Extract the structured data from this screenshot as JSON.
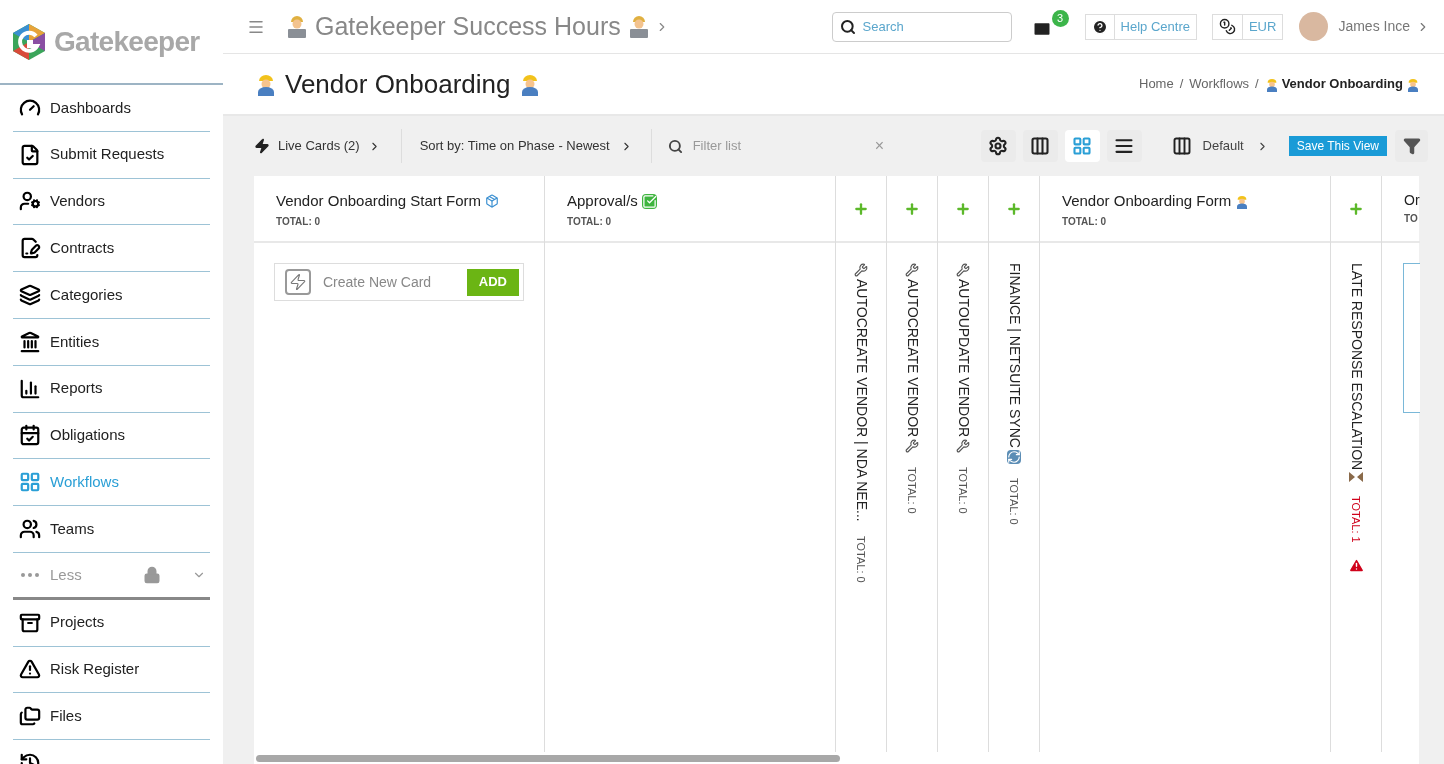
{
  "logo": {
    "text": "Gatekeeper"
  },
  "topbar": {
    "title": "Gatekeeper Success Hours",
    "search": {
      "placeholder": "Search"
    },
    "mail_badge": "3",
    "help": "Help Centre",
    "currency": "EUR",
    "user": "James Ince"
  },
  "sidebar": {
    "items": [
      {
        "kind": "link",
        "label": "Dashboards",
        "selected": false
      },
      {
        "kind": "link",
        "label": "Submit Requests",
        "selected": false
      },
      {
        "kind": "link",
        "label": "Vendors",
        "selected": false
      },
      {
        "kind": "link",
        "label": "Contracts",
        "selected": false
      },
      {
        "kind": "link",
        "label": "Categories",
        "selected": false
      },
      {
        "kind": "link",
        "label": "Entities",
        "selected": false
      },
      {
        "kind": "link",
        "label": "Reports",
        "selected": false
      },
      {
        "kind": "link",
        "label": "Obligations",
        "selected": false
      },
      {
        "kind": "link",
        "label": "Workflows",
        "selected": true
      },
      {
        "kind": "link",
        "label": "Teams",
        "selected": false
      },
      {
        "kind": "toggle",
        "label": "Less",
        "selected": false
      },
      {
        "kind": "link",
        "label": "Projects",
        "selected": false
      },
      {
        "kind": "link",
        "label": "Risk Register",
        "selected": false
      },
      {
        "kind": "link",
        "label": "Files",
        "selected": false
      },
      {
        "kind": "link",
        "selected": false
      }
    ]
  },
  "page": {
    "title": "Vendor Onboarding",
    "breadcrumbs": [
      {
        "label": "Home",
        "separator": "/"
      },
      {
        "label": "Workflows",
        "separator": "/"
      },
      {
        "label": "Vendor Onboarding"
      }
    ]
  },
  "toolbar": {
    "live_cards": "Live Cards (2)",
    "sort": "Sort by: Time on Phase - Newest",
    "filter": {
      "placeholder": "Filter list"
    },
    "clear": "×",
    "views": [
      {
        "selected": false
      },
      {
        "selected": false
      },
      {
        "selected": true
      },
      {
        "selected": false
      }
    ],
    "layout": "Default",
    "save": "Save This View"
  },
  "board": {
    "columns": [
      {
        "kind": "phase",
        "title": "Vendor Onboarding Start Form",
        "total": "TOTAL: 0",
        "create": {
          "placeholder": "Create New Card",
          "button": "ADD"
        }
      },
      {
        "kind": "phase",
        "title": "Approval/s",
        "total": "TOTAL: 0"
      },
      {
        "kind": "collapsed",
        "title": "AUTOCREATE VENDOR | NDA NEE...",
        "total": "TOTAL: 0",
        "alert": false
      },
      {
        "kind": "collapsed",
        "title": "AUTOCREATE VENDOR",
        "total": "TOTAL: 0",
        "alert": false
      },
      {
        "kind": "collapsed",
        "title": "AUTOUPDATE VENDOR",
        "total": "TOTAL: 0",
        "alert": false
      },
      {
        "kind": "collapsed",
        "title": "FINANCE | NETSUITE SYNC",
        "total": "TOTAL: 0",
        "alert": false
      },
      {
        "kind": "phase",
        "title": "Vendor Onboarding Form",
        "total": "TOTAL: 0"
      },
      {
        "kind": "collapsed",
        "title": "LATE RESPONSE ESCALATION",
        "total": "TOTAL: 1",
        "alert": true
      },
      {
        "kind": "partial",
        "title": "Or",
        "total": "TO"
      }
    ]
  }
}
